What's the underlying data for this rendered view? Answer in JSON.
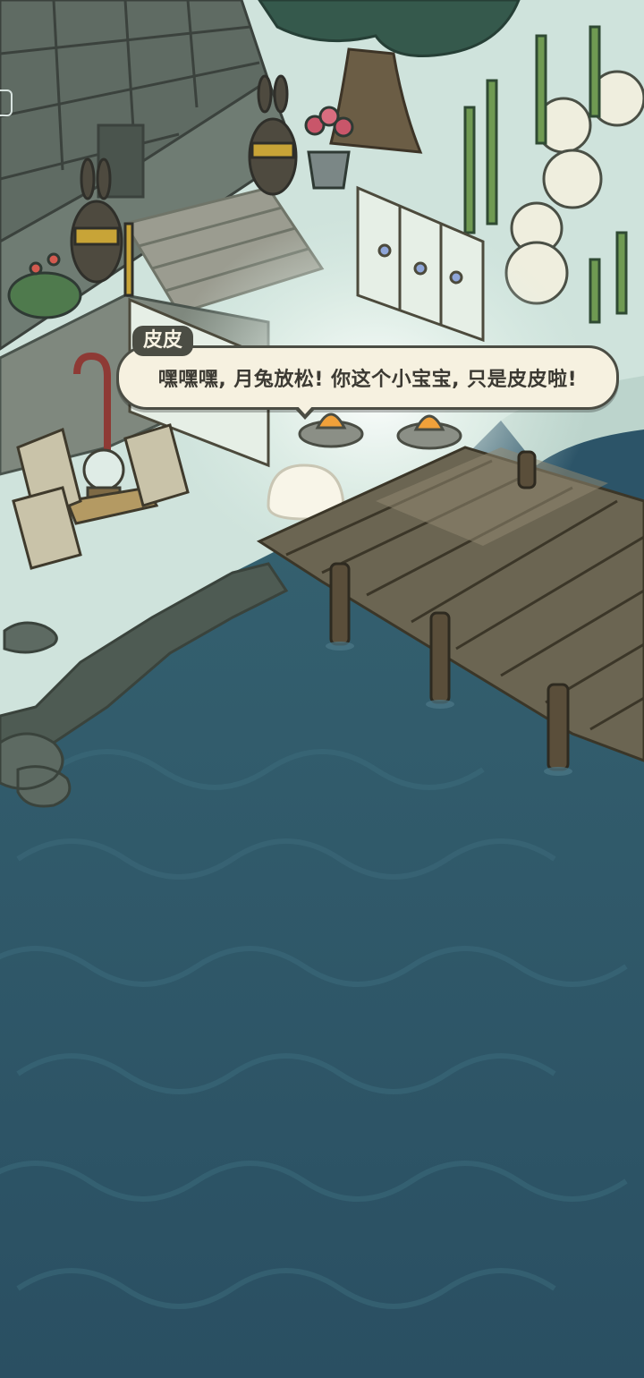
{
  "dialogue": {
    "speaker": "皮皮",
    "text": "嘿嘿嘿, 月兔放松! 你这个小宝宝, 只是皮皮啦!"
  },
  "scene": {
    "water_color": "#2c5468",
    "ground_color": "#cfe3dc",
    "dock_color": "#6b6552",
    "stone_color": "#5d6a62"
  },
  "icons": {
    "menu_edge": "side-menu-icon"
  }
}
